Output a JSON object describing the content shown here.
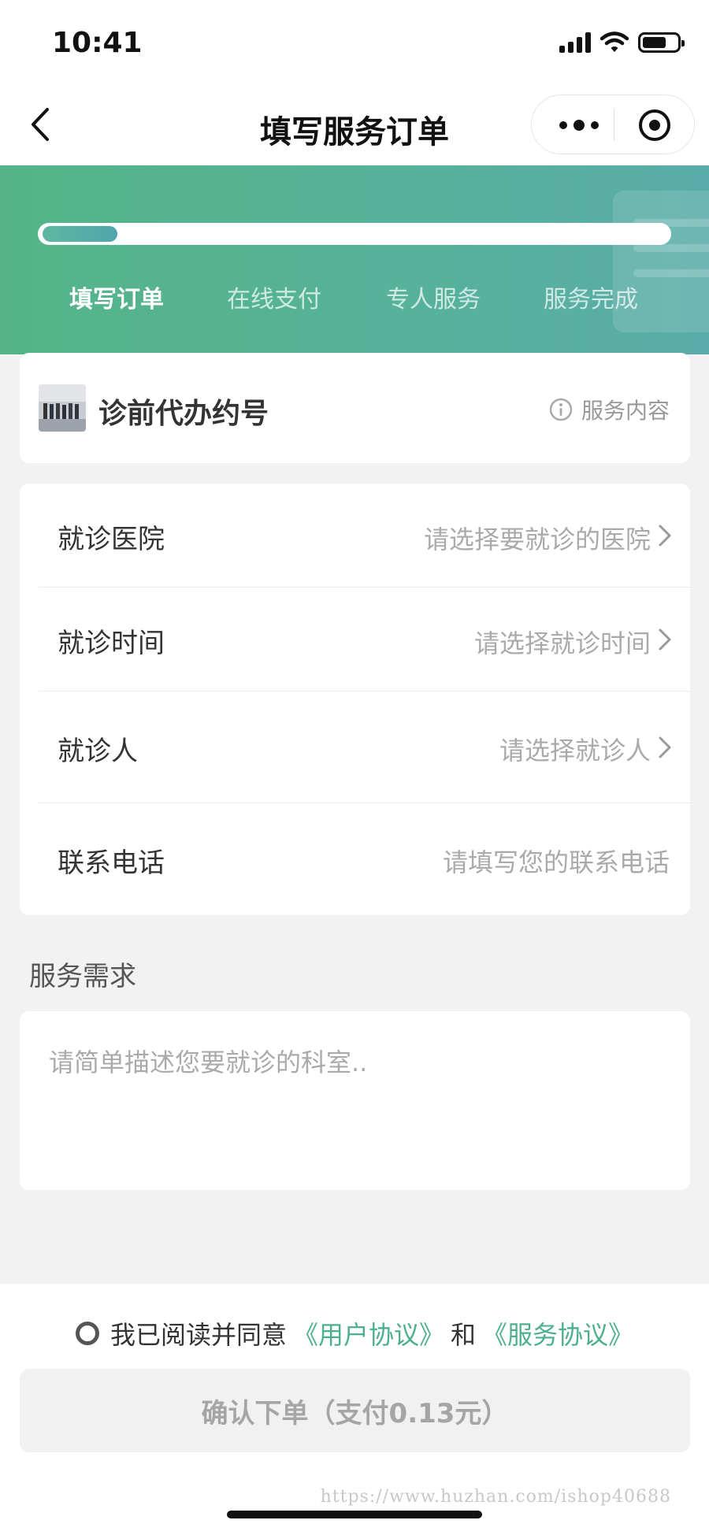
{
  "status_bar": {
    "time": "10:41"
  },
  "nav": {
    "title": "填写服务订单"
  },
  "progress": {
    "value": 0.12
  },
  "steps": [
    "填写订单",
    "在线支付",
    "专人服务",
    "服务完成"
  ],
  "service": {
    "name": "诊前代办约号",
    "link_label": "服务内容"
  },
  "form": {
    "rows": [
      {
        "label": "就诊医院",
        "placeholder": "请选择要就诊的医院"
      },
      {
        "label": "就诊时间",
        "placeholder": "请选择就诊时间"
      },
      {
        "label": "就诊人",
        "placeholder": "请选择就诊人"
      },
      {
        "label": "联系电话",
        "placeholder": "请填写您的联系电话"
      }
    ]
  },
  "requirements": {
    "label": "服务需求",
    "placeholder": "请简单描述您要就诊的科室.."
  },
  "agreement": {
    "prefix": "我已阅读并同意",
    "user_link": "《用户协议》",
    "conjunction": "和",
    "service_link": "《服务协议》"
  },
  "confirm_label": "确认下单（支付0.13元）",
  "watermark": "https://www.huzhan.com/ishop40688",
  "colors": {
    "accent": "#4db08c",
    "banner_start": "#54b488",
    "banner_end": "#5aacaa"
  }
}
